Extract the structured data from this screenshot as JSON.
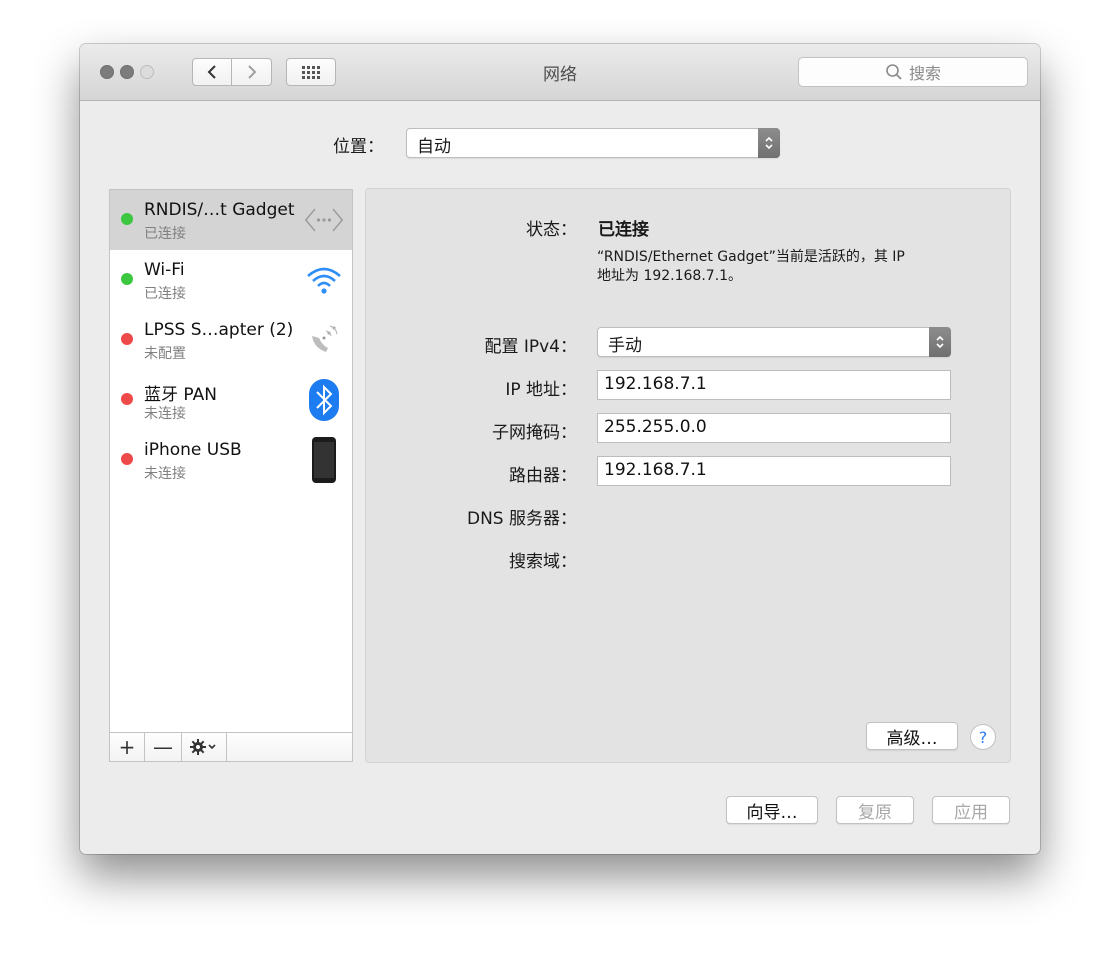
{
  "window": {
    "title": "网络",
    "search_placeholder": "搜索"
  },
  "location": {
    "label": "位置：",
    "value": "自动"
  },
  "services": [
    {
      "name": "RNDIS/…t Gadget",
      "status": "已连接",
      "dot": "#3bc73f",
      "icon": "ethernet-icon",
      "selected": true
    },
    {
      "name": "Wi-Fi",
      "status": "已连接",
      "dot": "#3bc73f",
      "icon": "wifi-icon"
    },
    {
      "name": "LPSS S…apter (2)",
      "status": "未配置",
      "dot": "#ef4a4a",
      "icon": "phone-modem-icon"
    },
    {
      "name": "蓝牙 PAN",
      "status": "未连接",
      "dot": "#ef4a4a",
      "icon": "bluetooth-icon"
    },
    {
      "name": "iPhone USB",
      "status": "未连接",
      "dot": "#ef4a4a",
      "icon": "iphone-icon"
    }
  ],
  "sidebar_tools": {
    "add": "+",
    "remove": "—",
    "gear": "✱⌄"
  },
  "detail": {
    "status_label": "状态：",
    "status_value": "已连接",
    "status_desc_line1": "“RNDIS/Ethernet Gadget”当前是活跃的，其 IP",
    "status_desc_line2": "地址为 192.168.7.1。",
    "ipv4_label": "配置 IPv4：",
    "ipv4_value": "手动",
    "ip_label": "IP 地址：",
    "ip_value": "192.168.7.1",
    "mask_label": "子网掩码：",
    "mask_value": "255.255.0.0",
    "router_label": "路由器：",
    "router_value": "192.168.7.1",
    "dns_label": "DNS 服务器：",
    "search_domain_label": "搜索域：",
    "advanced_button": "高级…",
    "help_button": "?"
  },
  "footer": {
    "assist_button": "向导…",
    "revert_button": "复原",
    "apply_button": "应用"
  },
  "colors": {
    "accent": "#2f7cf6",
    "connected": "#3bc73f",
    "disconnected": "#ef4a4a"
  }
}
